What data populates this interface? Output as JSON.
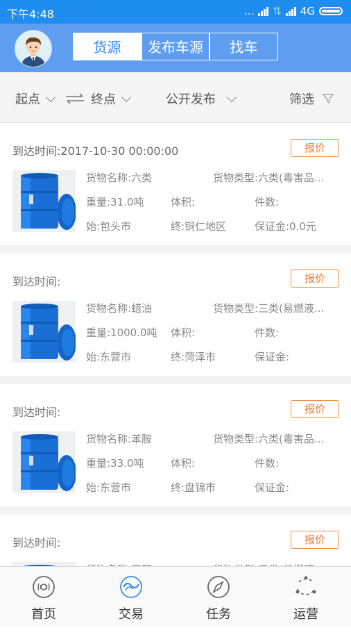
{
  "status_bar": {
    "time": "下午4:48",
    "dots": "...",
    "network": "4G"
  },
  "header": {
    "tabs": [
      {
        "label": "货源"
      },
      {
        "label": "发布车源"
      },
      {
        "label": "找车"
      }
    ],
    "active_tab": 0
  },
  "filters": {
    "origin": "起点",
    "destination": "终点",
    "publish": "公开发布",
    "filter": "筛选"
  },
  "listings": [
    {
      "arrival": "到达时间:2017-10-30 00:00:00",
      "quote_label": "报价",
      "cargo_name": "货物名称:六类",
      "cargo_type": "货物类型:六类(毒害品...",
      "weight": "重量:31.0吨",
      "volume": "体积:",
      "pieces": "件数:",
      "from": "始:包头市",
      "to": "终:铜仁地区",
      "deposit": "保证金:0.0元"
    },
    {
      "arrival": "到达时间:",
      "quote_label": "报价",
      "cargo_name": "货物名称:蜡油",
      "cargo_type": "货物类型:三类(易燃液...",
      "weight": "重量:1000.0吨",
      "volume": "体积:",
      "pieces": "件数:",
      "from": "始:东营市",
      "to": "终:菏泽市",
      "deposit": "保证金:"
    },
    {
      "arrival": "到达时间:",
      "quote_label": "报价",
      "cargo_name": "货物名称:苯胺",
      "cargo_type": "货物类型:六类(毒害品...",
      "weight": "重量:33.0吨",
      "volume": "体积:",
      "pieces": "件数:",
      "from": "始:东营市",
      "to": "终:盘锦市",
      "deposit": "保证金:"
    },
    {
      "arrival": "到达时间:",
      "quote_label": "报价",
      "cargo_name": "货物名称:甲醇",
      "cargo_type": "货物类型:三类(易燃液..."
    }
  ],
  "bottom_nav": [
    {
      "label": "首页",
      "icon": "home-icon"
    },
    {
      "label": "交易",
      "icon": "trade-icon"
    },
    {
      "label": "任务",
      "icon": "compass-icon"
    },
    {
      "label": "运营",
      "icon": "operations-icon"
    }
  ],
  "colors": {
    "status_bar": "#1f8cf0",
    "header": "#5e9df0",
    "quote_orange": "#f0782c",
    "active_tab_text": "#2f86f0"
  }
}
